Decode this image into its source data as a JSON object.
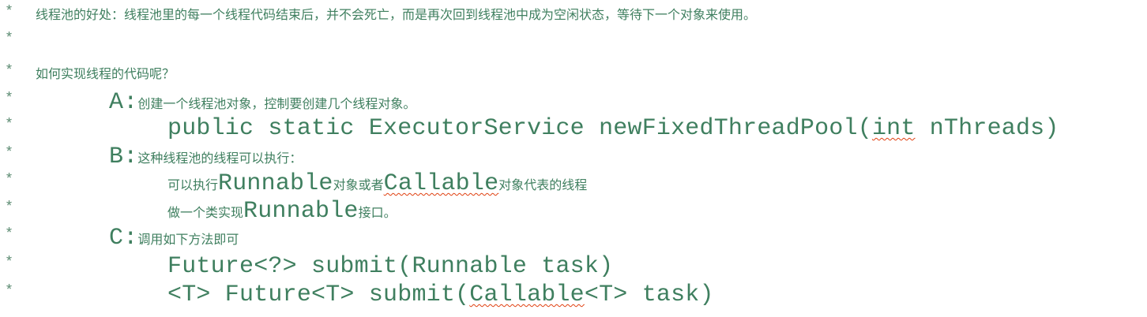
{
  "star": "*",
  "lines": [
    {
      "indent": 0,
      "segs": [
        {
          "t": "线程池的好处：线程池里的每一个线程代码结束后，并不会死亡，而是再次回到线程池中成为空闲状态，等待下一个对象来使用。",
          "k": "cn"
        }
      ]
    },
    {
      "indent": 0,
      "segs": []
    },
    {
      "indent": 0,
      "segs": [
        {
          "t": "如何实现线程的代码呢？",
          "k": "cn"
        }
      ]
    },
    {
      "indent": 1,
      "segs": [
        {
          "t": "A:",
          "k": "code"
        },
        {
          "t": "创建一个线程池对象，控制要创建几个线程对象。",
          "k": "cn"
        }
      ]
    },
    {
      "indent": 2,
      "segs": [
        {
          "t": "public static ExecutorService newFixedThreadPool(",
          "k": "code"
        },
        {
          "t": "int",
          "k": "code err"
        },
        {
          "t": " nThreads)",
          "k": "code"
        }
      ]
    },
    {
      "indent": 1,
      "segs": [
        {
          "t": "B:",
          "k": "code"
        },
        {
          "t": "这种线程池的线程可以执行：",
          "k": "cn"
        }
      ]
    },
    {
      "indent": 2,
      "segs": [
        {
          "t": "可以执行",
          "k": "cn"
        },
        {
          "t": "Runnable",
          "k": "code"
        },
        {
          "t": "对象或者",
          "k": "cn"
        },
        {
          "t": "Callable",
          "k": "code err"
        },
        {
          "t": "对象代表的线程",
          "k": "cn"
        }
      ]
    },
    {
      "indent": 2,
      "segs": [
        {
          "t": "做一个类实现",
          "k": "cn"
        },
        {
          "t": "Runnable",
          "k": "code"
        },
        {
          "t": "接口。",
          "k": "cn"
        }
      ]
    },
    {
      "indent": 1,
      "segs": [
        {
          "t": "C:",
          "k": "code"
        },
        {
          "t": "调用如下方法即可",
          "k": "cn"
        }
      ]
    },
    {
      "indent": 2,
      "segs": [
        {
          "t": "Future<?> submit(Runnable task)",
          "k": "code"
        }
      ]
    },
    {
      "indent": 2,
      "segs": [
        {
          "t": "<T> Future<T> submit(",
          "k": "code"
        },
        {
          "t": "Callable",
          "k": "code err"
        },
        {
          "t": "<T> task)",
          "k": "code"
        }
      ]
    }
  ]
}
